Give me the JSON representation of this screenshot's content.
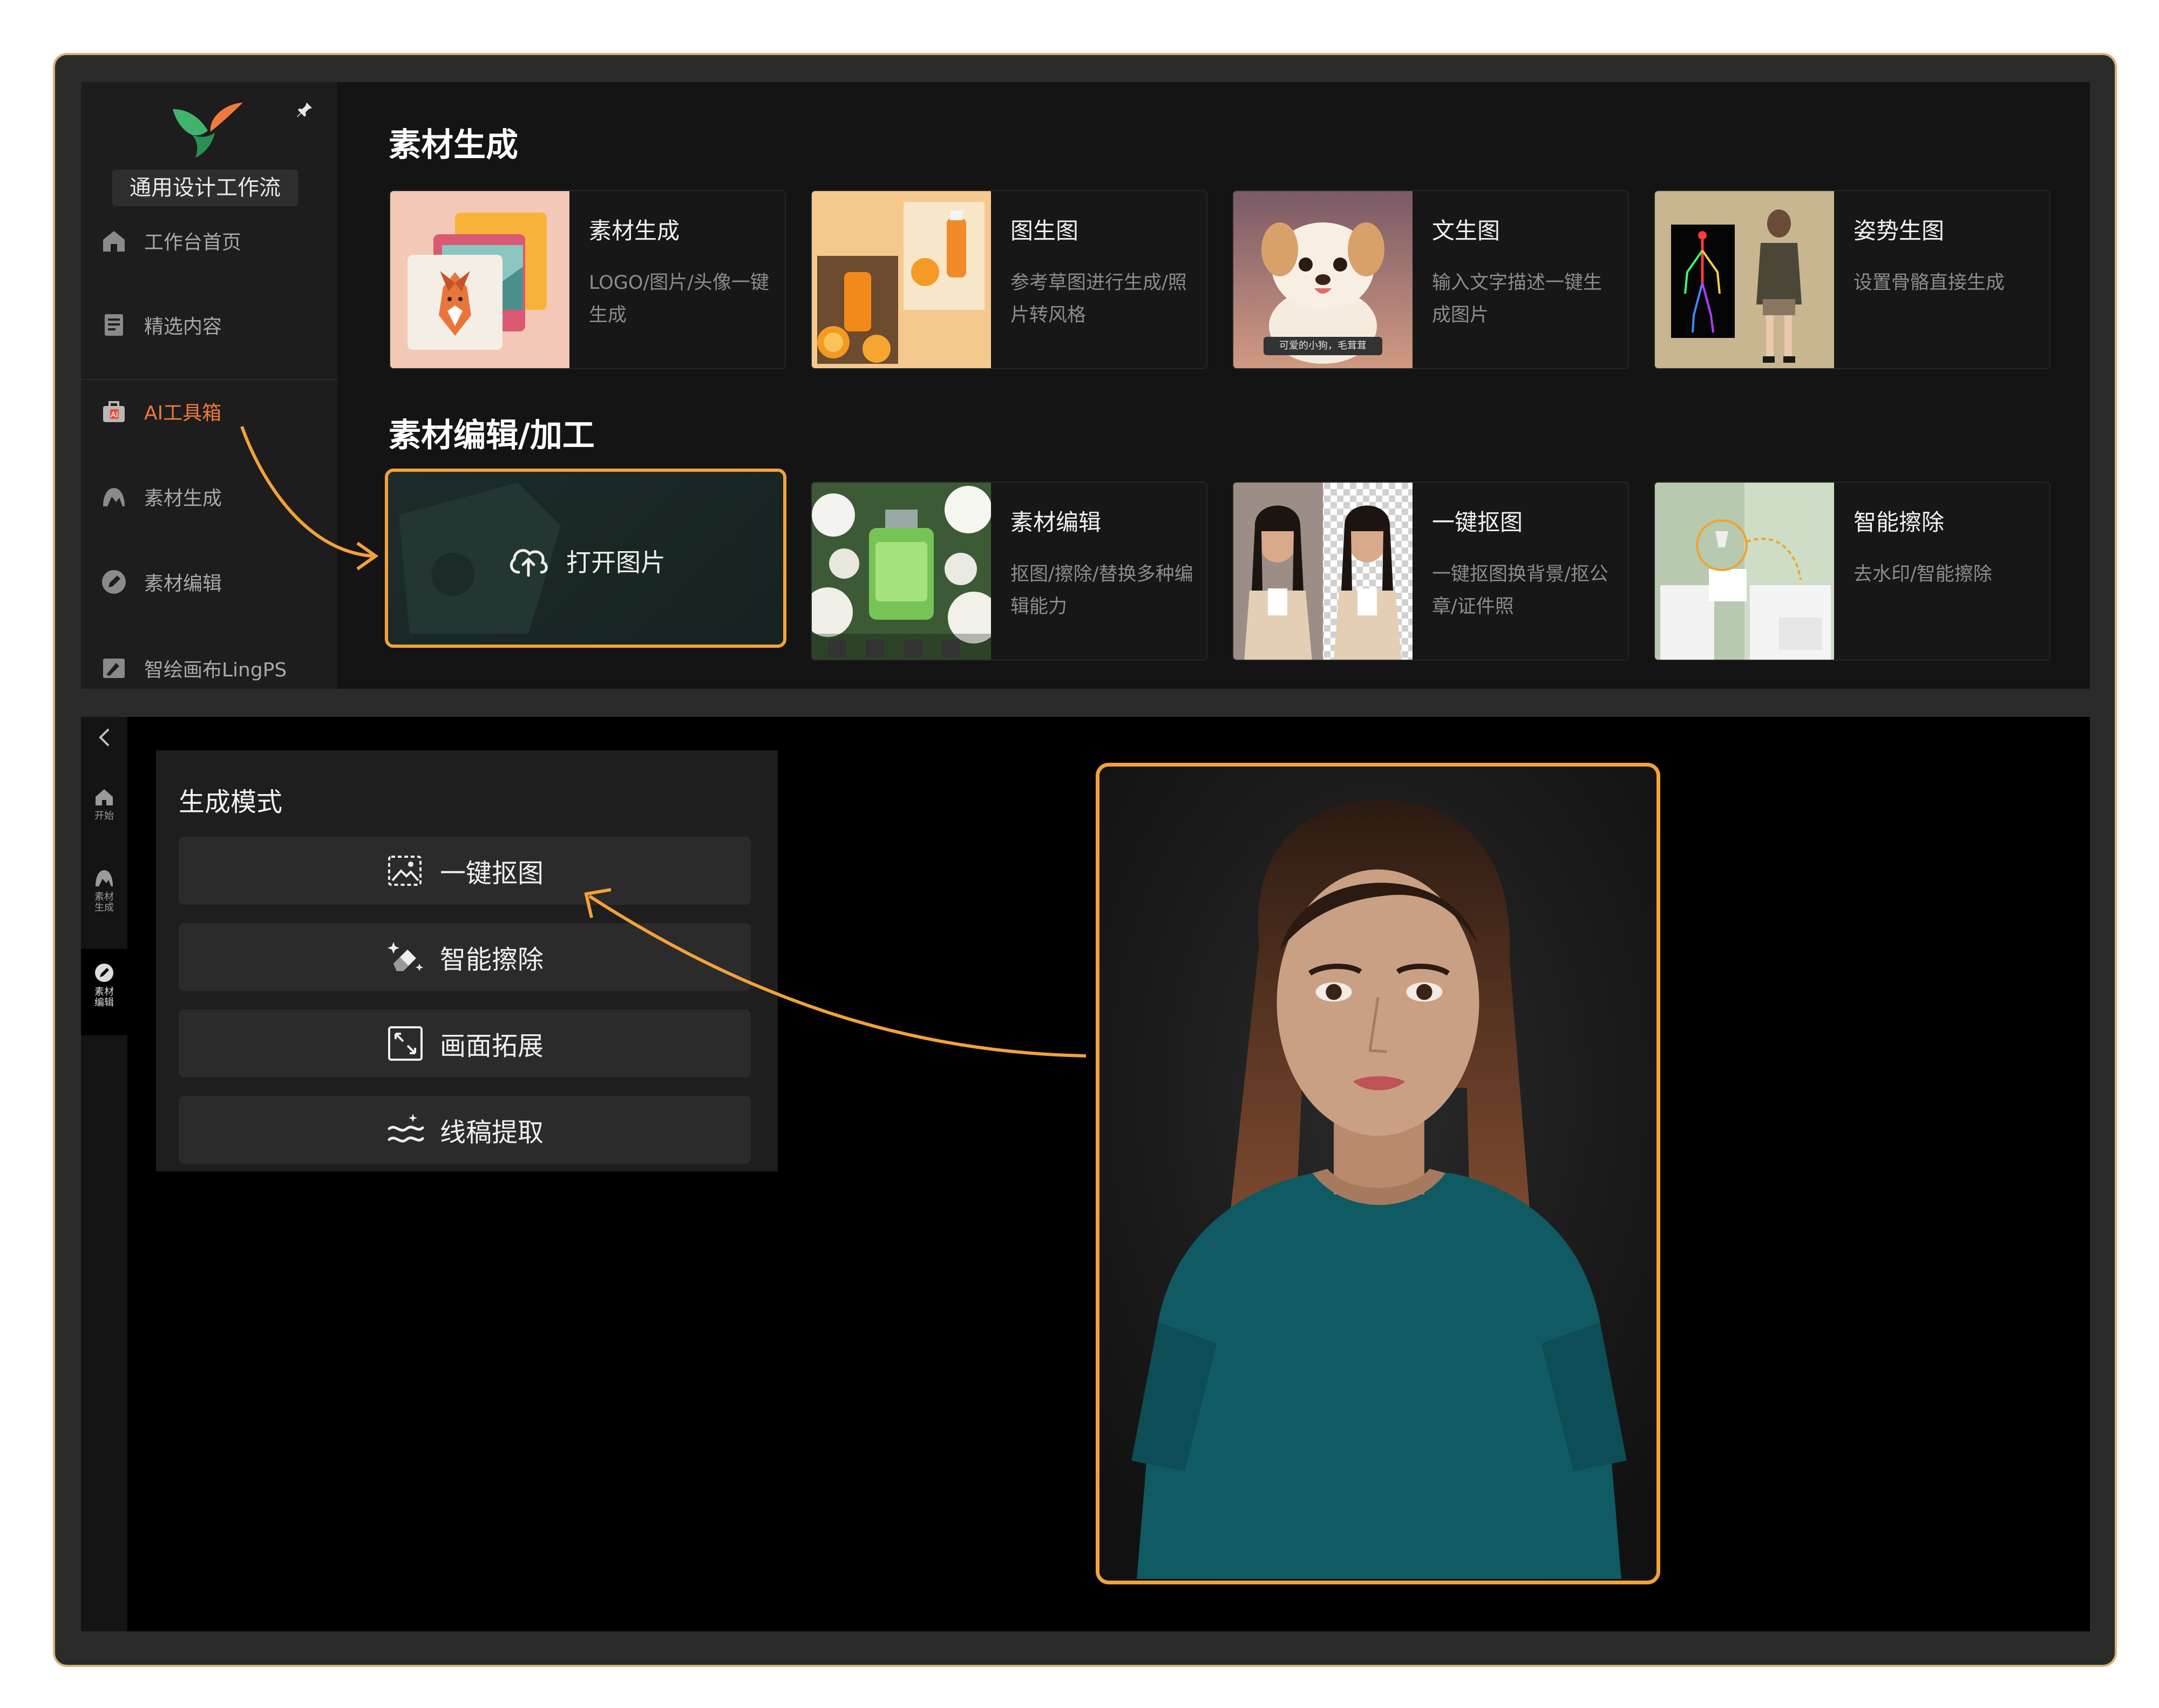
{
  "sidebar": {
    "workflow_label": "通用设计工作流",
    "items": [
      {
        "label": "工作台首页"
      },
      {
        "label": "精选内容"
      },
      {
        "label": "AI工具箱"
      },
      {
        "label": "素材生成"
      },
      {
        "label": "素材编辑"
      },
      {
        "label": "智绘画布LingPS"
      }
    ]
  },
  "sections": {
    "generation": {
      "title": "素材生成",
      "cards": [
        {
          "title": "素材生成",
          "desc": "LOGO/图片/头像一键生成"
        },
        {
          "title": "图生图",
          "desc": "参考草图进行生成/照片转风格"
        },
        {
          "title": "文生图",
          "desc": "输入文字描述一键生成图片",
          "caption": "可爱的小狗，毛茸茸"
        },
        {
          "title": "姿势生图",
          "desc": "设置骨骼直接生成"
        }
      ]
    },
    "editing": {
      "title": "素材编辑/加工",
      "open_label": "打开图片",
      "cards": [
        {
          "title": "素材编辑",
          "desc": "抠图/擦除/替换多种编辑能力"
        },
        {
          "title": "一键抠图",
          "desc": "一键抠图换背景/抠公章/证件照"
        },
        {
          "title": "智能擦除",
          "desc": "去水印/智能擦除"
        }
      ]
    }
  },
  "rail": {
    "items": [
      {
        "label": "开始"
      },
      {
        "label": "素材生成"
      },
      {
        "label": "素材编辑"
      }
    ]
  },
  "mode_panel": {
    "title": "生成模式",
    "buttons": [
      {
        "label": "一键抠图"
      },
      {
        "label": "智能擦除"
      },
      {
        "label": "画面拓展"
      },
      {
        "label": "线稿提取"
      }
    ]
  },
  "colors": {
    "accent": "#f2a23a",
    "active_nav": "#f07a3e",
    "logo_green": "#3fb56b",
    "logo_orange": "#f07a3e"
  }
}
